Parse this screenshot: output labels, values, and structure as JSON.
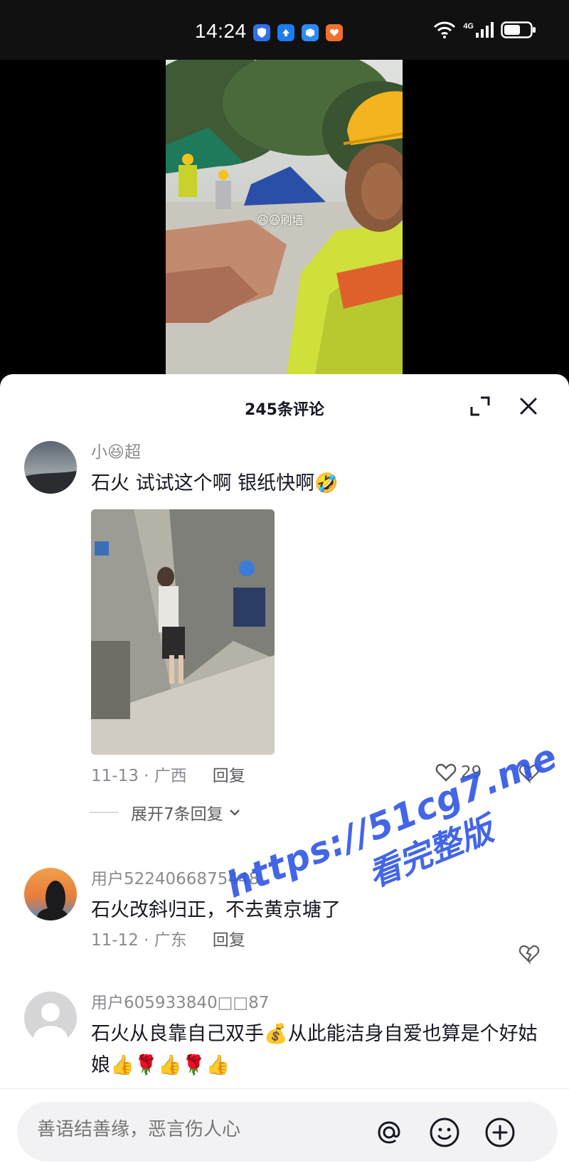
{
  "status_bar": {
    "time": "14:24",
    "network": "4G"
  },
  "video": {
    "caption": "😆😆刷墙"
  },
  "comments_panel": {
    "title": "245条评论",
    "comments": [
      {
        "username": "小😆超",
        "text": "石火 试试这个啊 银纸快啊🤣",
        "date_location": "11-13 · 广西",
        "reply_label": "回复",
        "likes": "29",
        "expand_replies": "展开7条回复"
      },
      {
        "username": "用户5224066875448",
        "text": "石火改斜归正，不去黄京塘了",
        "date_location": "11-12 · 广东",
        "reply_label": "回复"
      },
      {
        "username": "用户605933840□□87",
        "text": "石火从良靠自己双手💰从此能洁身自爱也算是个好姑娘👍🌹👍🌹👍"
      }
    ]
  },
  "watermark": {
    "line1": "https://51cg7.me",
    "line2": "看完整版"
  },
  "input_bar": {
    "placeholder": "善语结善缘，恶言伤人心"
  },
  "colors": {
    "accent_text": "#161823",
    "secondary_text": "#8a8b91",
    "watermark": "#2f56e6"
  }
}
